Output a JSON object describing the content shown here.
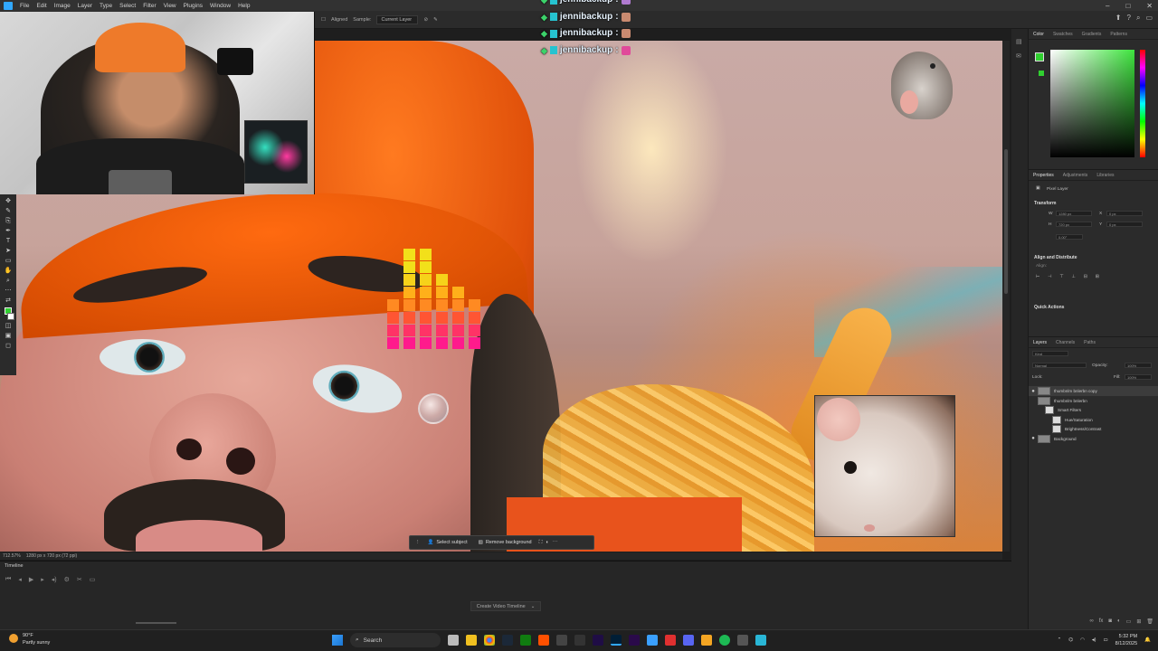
{
  "menubar": {
    "items": [
      "File",
      "Edit",
      "Image",
      "Layer",
      "Type",
      "Select",
      "Filter",
      "View",
      "Plugins",
      "Window",
      "Help"
    ]
  },
  "optbar": {
    "aligned_label": "Aligned",
    "sample_label": "Sample:",
    "sample_value": "Current Layer"
  },
  "chat": {
    "lines": [
      {
        "user": "jennibackup",
        "sep": ":",
        "emote_color": "#b07ad0"
      },
      {
        "user": "jennibackup",
        "sep": ":",
        "emote_color": "#c98a70"
      },
      {
        "user": "jennibackup",
        "sep": ":",
        "emote_color": "#c98a70"
      },
      {
        "user": "jennibackup",
        "sep": ":",
        "emote_color": "#e04a9a"
      }
    ]
  },
  "status": {
    "zoom": "712.57%",
    "doc_size": "1280 px x 720 px (72 ppi)"
  },
  "context_bar": {
    "select_subject": "Select subject",
    "remove_background": "Remove background"
  },
  "timeline": {
    "title": "Timeline",
    "create_button": "Create Video Timeline"
  },
  "color_panel": {
    "tabs": [
      "Color",
      "Swatches",
      "Gradients",
      "Patterns"
    ],
    "foreground": "#30d030"
  },
  "properties": {
    "tabs": [
      "Properties",
      "Adjustments",
      "Libraries"
    ],
    "layer_type": "Pixel Layer",
    "transform_title": "Transform",
    "w_label": "W",
    "w_value": "1280 px",
    "h_label": "H",
    "h_value": "720 px",
    "x_label": "X",
    "x_value": "0 px",
    "y_label": "Y",
    "y_value": "0 px",
    "angle_value": "0.00°",
    "align_title": "Align and Distribute",
    "align_sub": "Align:",
    "quick_actions_title": "Quick Actions"
  },
  "layers": {
    "tabs": [
      "Layers",
      "Channels",
      "Paths"
    ],
    "kind_value": "Kind",
    "blend_mode": "Normal",
    "opacity_label": "Opacity:",
    "opacity_value": "100%",
    "lock_label": "Lock:",
    "fill_label": "Fill:",
    "fill_value": "100%",
    "rows": [
      {
        "name": "thumbnlm bnlerbn copy",
        "selected": true,
        "eye": "●",
        "indent": 0
      },
      {
        "name": "thumbnlm bnlerbn",
        "selected": false,
        "eye": "",
        "indent": 0
      },
      {
        "name": "Smart Filters",
        "selected": false,
        "eye": "",
        "indent": 1
      },
      {
        "name": "Hue/Saturation",
        "selected": false,
        "eye": "",
        "indent": 2
      },
      {
        "name": "Brightness/Contrast",
        "selected": false,
        "eye": "",
        "indent": 2
      },
      {
        "name": "Background",
        "selected": false,
        "eye": "●",
        "indent": 0
      }
    ]
  },
  "taskbar": {
    "weather_temp": "90°F",
    "weather_desc": "Partly sunny",
    "search_placeholder": "Search",
    "time": "5:32 PM",
    "date": "8/12/2025"
  }
}
